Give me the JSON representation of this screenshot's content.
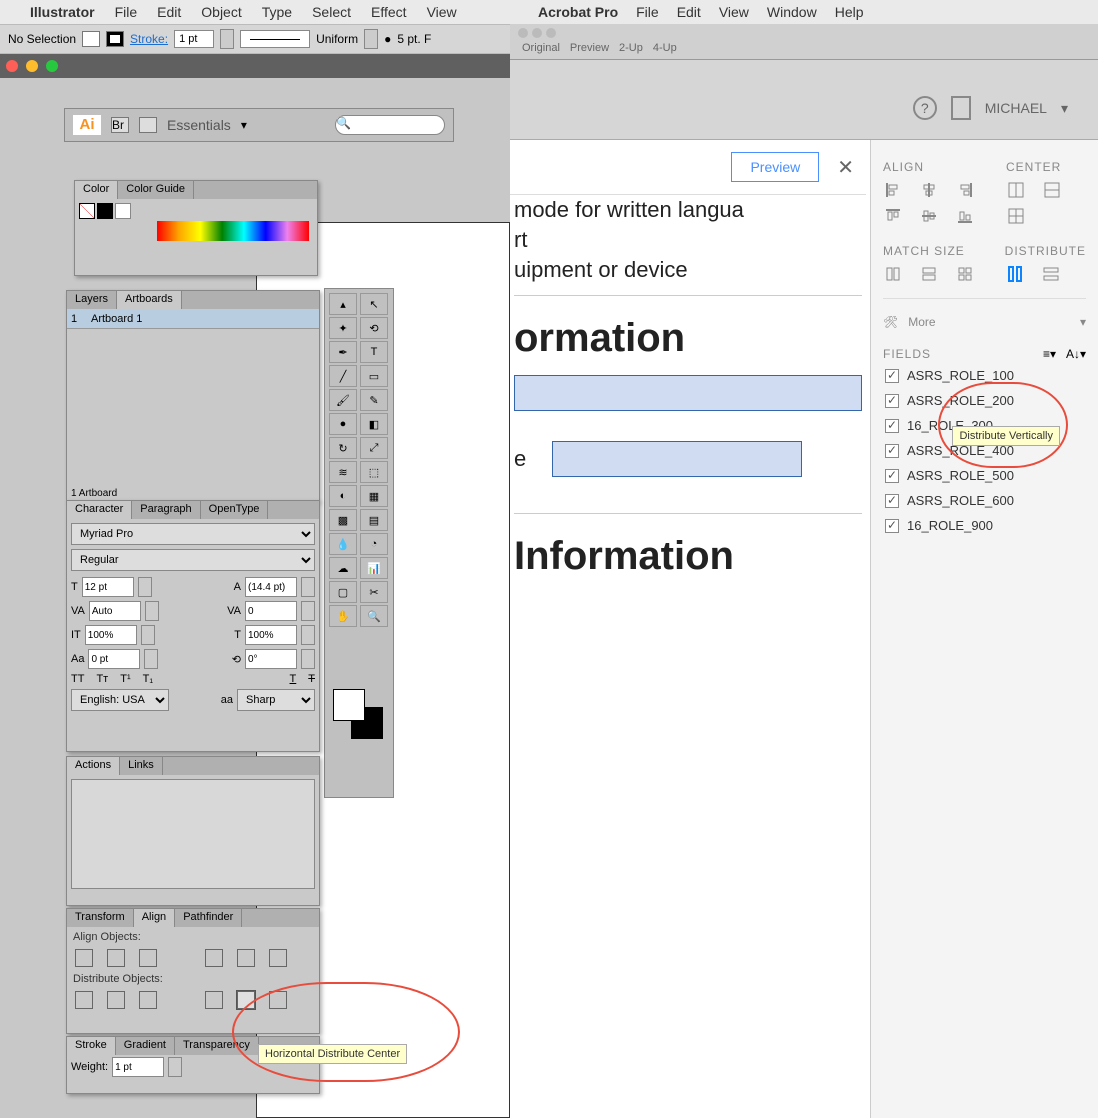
{
  "illustrator": {
    "app": "Illustrator",
    "menus": [
      "File",
      "Edit",
      "Object",
      "Type",
      "Select",
      "Effect",
      "View"
    ],
    "options": {
      "selection": "No Selection",
      "stroke_label": "Stroke:",
      "stroke_value": "1 pt",
      "style_label": "Uniform",
      "point_label": "5 pt. F"
    },
    "appbar": {
      "logo": "Ai",
      "workspace": "Essentials"
    },
    "color_panel": {
      "tabs": [
        "Color",
        "Color Guide"
      ]
    },
    "layers_panel": {
      "tabs": [
        "Layers",
        "Artboards"
      ],
      "row_num": "1",
      "row_name": "Artboard 1",
      "footer": "1 Artboard"
    },
    "char_panel": {
      "tabs": [
        "Character",
        "Paragraph",
        "OpenType"
      ],
      "font": "Myriad Pro",
      "style": "Regular",
      "size": "12 pt",
      "leading": "(14.4 pt)",
      "kerning": "Auto",
      "tracking": "0",
      "vscale": "100%",
      "hscale": "100%",
      "baseline": "0 pt",
      "rotation": "0°",
      "lang": "English: USA",
      "antialias": "Sharp"
    },
    "actions_panel": {
      "tabs": [
        "Actions",
        "Links"
      ]
    },
    "align_panel": {
      "tabs": [
        "Transform",
        "Align",
        "Pathfinder"
      ],
      "section1": "Align Objects:",
      "section2": "Distribute Objects:"
    },
    "stroke_panel": {
      "tabs": [
        "Stroke",
        "Gradient",
        "Transparency"
      ],
      "weight_label": "Weight:",
      "weight_value": "1 pt"
    },
    "tooltip": "Horizontal Distribute Center"
  },
  "acrobat": {
    "app": "Acrobat Pro",
    "menus": [
      "File",
      "Edit",
      "View",
      "Window",
      "Help"
    ],
    "tabs": [
      "Original",
      "Preview",
      "2-Up",
      "4-Up"
    ],
    "user": "MICHAEL",
    "preview_btn": "Preview",
    "doc_lines": [
      "mode for written langua",
      "rt",
      "uipment or device"
    ],
    "doc_h1": "ormation",
    "doc_e": "e",
    "doc_h2": "Information",
    "sidebar": {
      "align_h": "ALIGN",
      "center_h": "CENTER",
      "match_h": "MATCH SIZE",
      "distribute_h": "DISTRIBUTE",
      "more": "More",
      "fields_h": "FIELDS",
      "fields": [
        "ASRS_ROLE_100",
        "ASRS_ROLE_200",
        "16_ROLE_300",
        "ASRS_ROLE_400",
        "ASRS_ROLE_500",
        "ASRS_ROLE_600",
        "16_ROLE_900"
      ]
    },
    "tooltip": "Distribute Vertically"
  }
}
